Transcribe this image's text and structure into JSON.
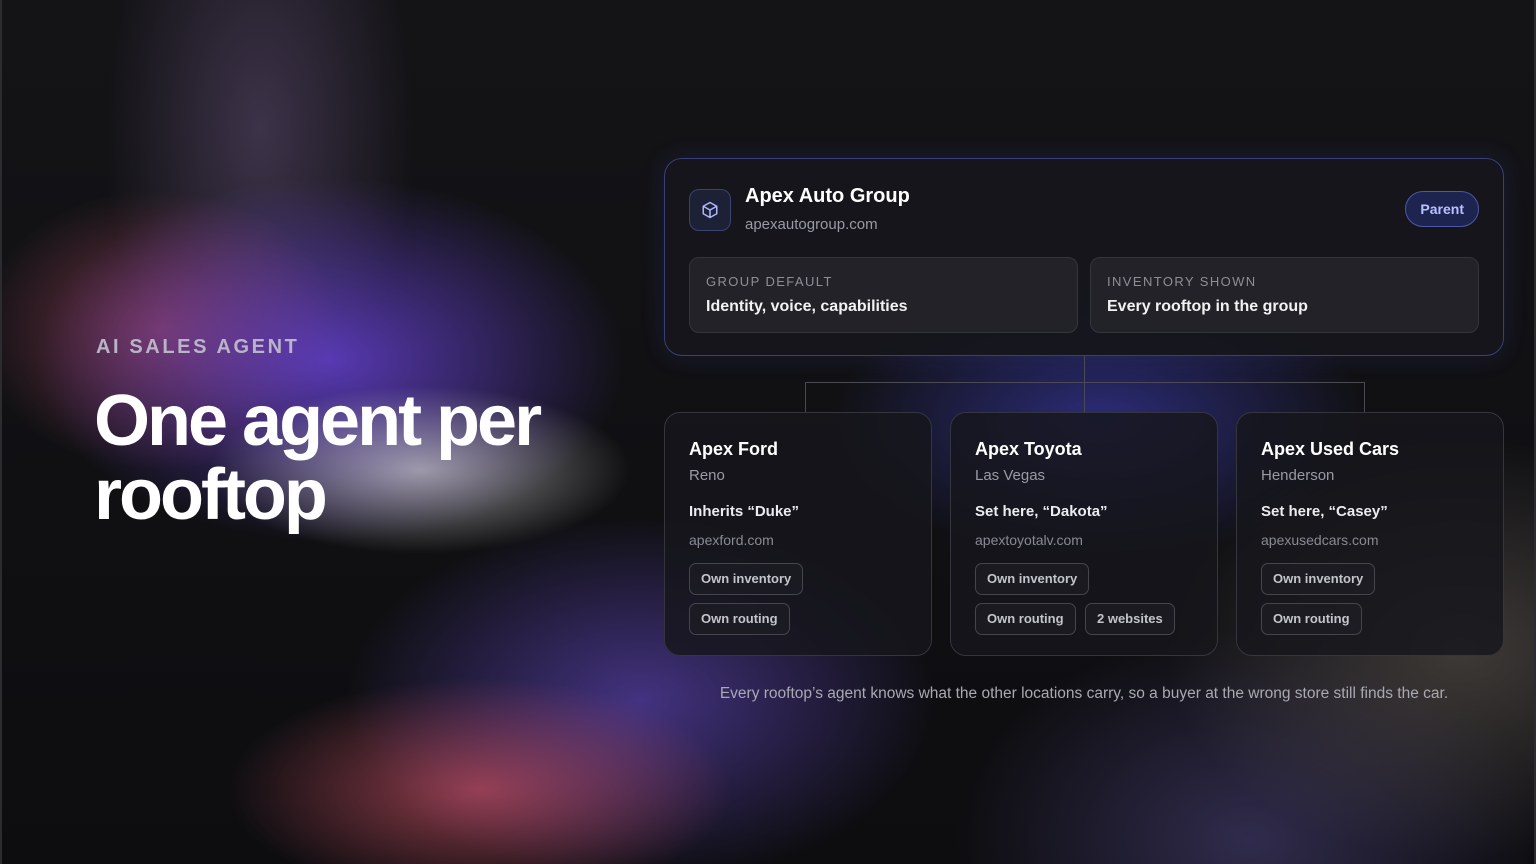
{
  "hero": {
    "eyebrow": "AI SALES AGENT",
    "headline": "One agent per rooftop"
  },
  "parent": {
    "icon": "cube-icon",
    "name": "Apex Auto Group",
    "url": "apexautogroup.com",
    "badge": "Parent",
    "defaults": [
      {
        "label": "GROUP DEFAULT",
        "value": "Identity, voice, capabilities"
      },
      {
        "label": "INVENTORY SHOWN",
        "value": "Every rooftop in the group"
      }
    ]
  },
  "children": [
    {
      "name": "Apex Ford",
      "city": "Reno",
      "agent": "Inherits “Duke”",
      "url": "apexford.com",
      "tags": [
        "Own inventory",
        "Own routing"
      ]
    },
    {
      "name": "Apex Toyota",
      "city": "Las Vegas",
      "agent": "Set here, “Dakota”",
      "url": "apextoyotalv.com",
      "tags": [
        "Own inventory",
        "Own routing",
        "2 websites"
      ]
    },
    {
      "name": "Apex Used Cars",
      "city": "Henderson",
      "agent": "Set here, “Casey”",
      "url": "apexusedcars.com",
      "tags": [
        "Own inventory",
        "Own routing"
      ]
    }
  ],
  "footnote": "Every rooftop’s agent knows what the other locations carry, so a buyer at the wrong store still finds the car.",
  "colors": {
    "accent_border": "#3a3f78",
    "badge_bg": "#1e2450",
    "badge_text": "#b8c0ff"
  }
}
